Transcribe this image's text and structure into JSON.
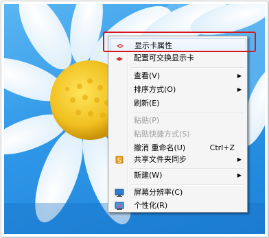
{
  "context_menu": {
    "items": [
      {
        "label": "显示卡属性",
        "shortcut": "",
        "submenu": false,
        "disabled": false,
        "highlighted": true,
        "icon": "graphics-adapter-icon"
      },
      {
        "label": "配置可交换显示卡",
        "shortcut": "",
        "submenu": false,
        "disabled": false,
        "highlighted": false,
        "icon": "switchable-graphics-icon"
      },
      {
        "label": "查看(V)",
        "shortcut": "",
        "submenu": true,
        "disabled": false,
        "highlighted": false,
        "icon": ""
      },
      {
        "label": "排序方式(O)",
        "shortcut": "",
        "submenu": true,
        "disabled": false,
        "highlighted": false,
        "icon": ""
      },
      {
        "label": "刷新(E)",
        "shortcut": "",
        "submenu": false,
        "disabled": false,
        "highlighted": false,
        "icon": ""
      },
      {
        "label": "粘贴(P)",
        "shortcut": "",
        "submenu": false,
        "disabled": true,
        "highlighted": false,
        "icon": ""
      },
      {
        "label": "粘贴快捷方式(S)",
        "shortcut": "",
        "submenu": false,
        "disabled": true,
        "highlighted": false,
        "icon": ""
      },
      {
        "label": "撤消 重命名(U)",
        "shortcut": "Ctrl+Z",
        "submenu": false,
        "disabled": false,
        "highlighted": false,
        "icon": ""
      },
      {
        "label": "共享文件夹同步",
        "shortcut": "",
        "submenu": true,
        "disabled": false,
        "highlighted": false,
        "icon": "sync-folder-icon"
      },
      {
        "label": "新建(W)",
        "shortcut": "",
        "submenu": true,
        "disabled": false,
        "highlighted": false,
        "icon": ""
      },
      {
        "label": "屏幕分辨率(C)",
        "shortcut": "",
        "submenu": false,
        "disabled": false,
        "highlighted": false,
        "icon": "screen-resolution-icon"
      },
      {
        "label": "个性化(R)",
        "shortcut": "",
        "submenu": false,
        "disabled": false,
        "highlighted": false,
        "icon": "personalize-icon"
      }
    ],
    "submenu_arrow": "▶"
  },
  "colors": {
    "desktop_sky": "#2f97e8",
    "flower_center": "#f0c020",
    "highlight_frame": "#d81818",
    "menu_background": "#f5f5f5"
  }
}
